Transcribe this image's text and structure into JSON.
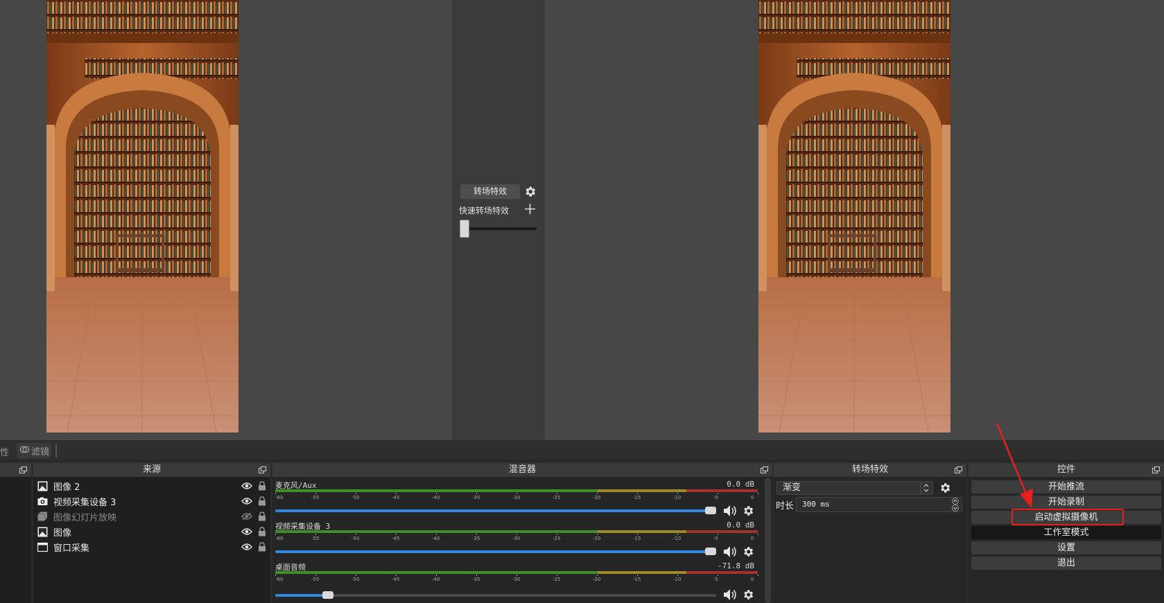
{
  "top_tabs": {
    "properties_fragment": "性",
    "filters_label": "滤镜"
  },
  "preview": {
    "transition_button": "转场特效",
    "quick_transitions_label": "快速转场特效"
  },
  "sources": {
    "title": "来源",
    "items": [
      {
        "name": "图像 2",
        "icon": "image-icon",
        "visible": true,
        "locked": false
      },
      {
        "name": "视频采集设备 3",
        "icon": "camera-icon",
        "visible": true,
        "locked": false
      },
      {
        "name": "图像幻灯片放映",
        "icon": "slideshow-icon",
        "visible": false,
        "locked": false
      },
      {
        "name": "图像",
        "icon": "image-icon",
        "visible": true,
        "locked": false
      },
      {
        "name": "窗口采集",
        "icon": "window-icon",
        "visible": true,
        "locked": false
      }
    ]
  },
  "mixer": {
    "title": "混音器",
    "scale_ticks": [
      "-60",
      "-55",
      "-50",
      "-45",
      "-40",
      "-35",
      "-30",
      "-25",
      "-20",
      "-15",
      "-10",
      "-5",
      "0"
    ],
    "channels": [
      {
        "name": "麦克风/Aux",
        "db": "0.0 dB",
        "volume": 1.0
      },
      {
        "name": "视频采集设备 3",
        "db": "0.0 dB",
        "volume": 1.0
      },
      {
        "name": "桌面音频",
        "db": "-71.8 dB",
        "volume": 0.11
      }
    ]
  },
  "transitions": {
    "title": "转场特效",
    "selected": "渐变",
    "duration_label": "时长",
    "duration_value": "300 ms"
  },
  "controls": {
    "title": "控件",
    "buttons": {
      "start_stream": "开始推流",
      "start_record": "开始录制",
      "start_virtual_cam": "启动虚拟摄像机",
      "studio_mode": "工作室模式",
      "settings": "设置",
      "exit": "退出"
    }
  },
  "colors": {
    "highlight": "#e81e1e",
    "volume_fill": "#2f87e0"
  }
}
